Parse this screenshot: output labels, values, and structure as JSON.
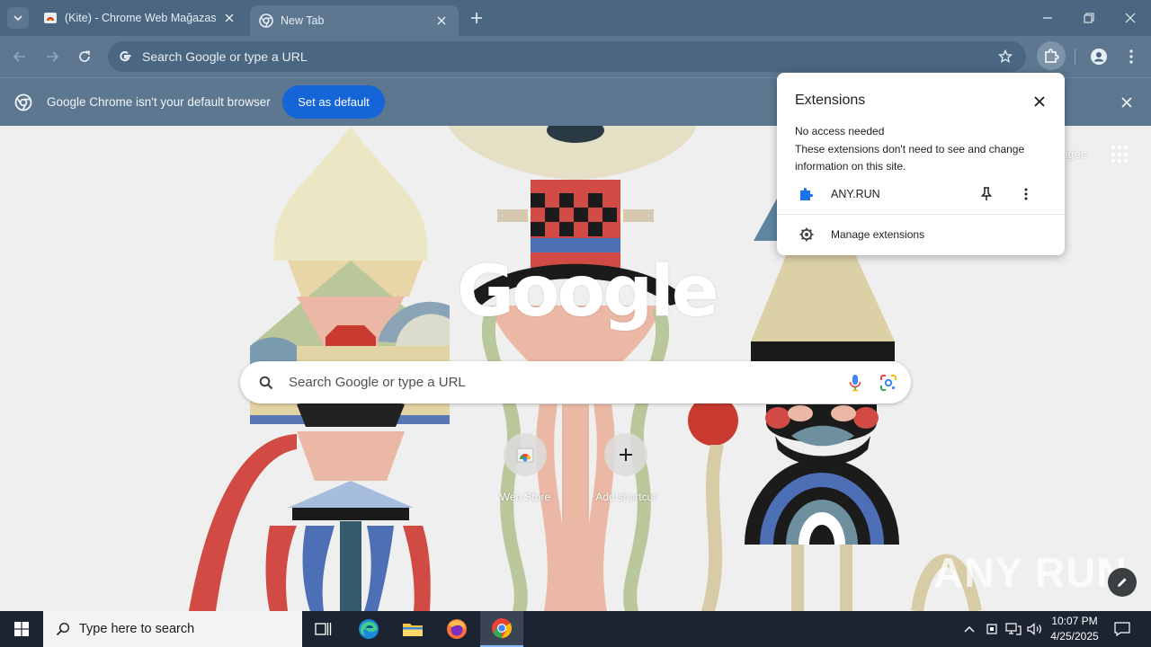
{
  "browser": {
    "tabs": [
      {
        "title": "(Kite) - Chrome Web Mağazası",
        "active": false
      },
      {
        "title": "New Tab",
        "active": true
      }
    ],
    "omnibox_placeholder": "Search Google or type a URL"
  },
  "infobar": {
    "message": "Google Chrome isn't your default browser",
    "button": "Set as default"
  },
  "extensions_popup": {
    "title": "Extensions",
    "section_title": "No access needed",
    "section_desc": "These extensions don't need to see and change information on this site.",
    "items": [
      {
        "name": "ANY.RUN",
        "icon": "puzzle-icon"
      }
    ],
    "manage_label": "Manage extensions"
  },
  "ntp": {
    "logo": "Google",
    "search_placeholder": "Search Google or type a URL",
    "apps_label": "ages",
    "shortcuts": [
      {
        "label": "Web Store",
        "icon": "webstore-icon"
      },
      {
        "label": "Add shortcut",
        "icon": "plus-icon"
      }
    ],
    "watermark": "ANY RUN"
  },
  "taskbar": {
    "search_placeholder": "Type here to search",
    "apps": [
      "task-view",
      "edge",
      "file-explorer",
      "firefox",
      "chrome"
    ],
    "time": "10:07 PM",
    "date": "4/25/2025"
  },
  "colors": {
    "frame": "#4a6680",
    "toolbar": "#5d7790",
    "accent_button": "#1565d8",
    "taskbar": "#1c2331"
  }
}
